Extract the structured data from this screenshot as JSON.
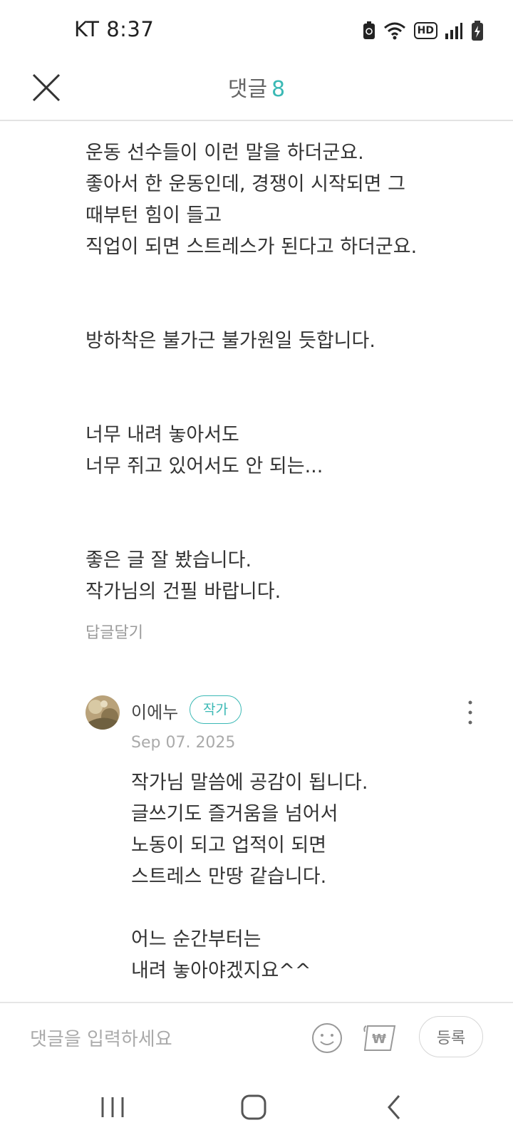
{
  "status": {
    "carrier_time": "KT 8:37",
    "network_label": "HD"
  },
  "header": {
    "title": "댓글",
    "count": "8"
  },
  "comment": {
    "lines": [
      "운동 선수들이 이런 말을 하더군요.",
      "좋아서 한 운동인데, 경쟁이 시작되면 그",
      "때부턴 힘이 들고",
      "직업이 되면 스트레스가 된다고 하더군요.",
      "방하착은 불가근 불가원일 듯합니다.",
      "너무 내려 놓아서도",
      "너무 쥐고 있어서도 안 되는...",
      "좋은 글 잘 봤습니다.",
      "작가님의 건필 바랍니다."
    ],
    "reply_action": "답글달기"
  },
  "reply": {
    "author": "이에누",
    "badge": "작가",
    "date": "Sep 07. 2025",
    "lines": [
      "작가님 말씀에 공감이 됩니다.",
      "글쓰기도 즐거움을 넘어서",
      "노동이 되고 업적이 되면",
      "스트레스 만땅 같습니다.",
      "어느 순간부터는",
      "내려 놓아야겠지요^^"
    ]
  },
  "input": {
    "placeholder": "댓글을 입력하세요",
    "submit_label": "등록"
  },
  "icons": {
    "close": "close-icon",
    "more": "more-vertical-icon",
    "emoji": "emoji-icon",
    "tip": "won-tip-icon",
    "nav_recent": "recent-apps-icon",
    "nav_home": "home-icon",
    "nav_back": "back-icon"
  },
  "colors": {
    "accent": "#3bb9b5",
    "text": "#333333",
    "muted": "#9a9a9a"
  }
}
